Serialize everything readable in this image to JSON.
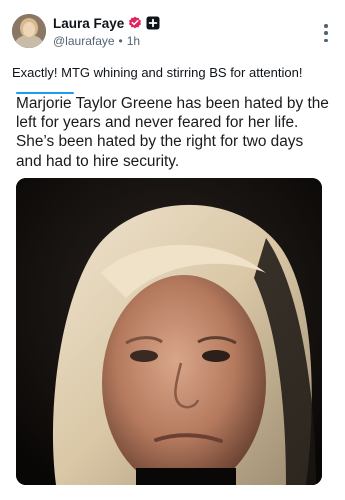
{
  "author": {
    "display_name": "Laura Faye",
    "handle": "@laurafaye",
    "separator": "•",
    "time_ago": "1h",
    "verified_badge_color": "#e0245e"
  },
  "post": {
    "text": "Exactly! MTG whining and stirring BS for attention!"
  },
  "quoted_image": {
    "caption_text": "Marjorie Taylor Greene has been hated by the left for years and never feared for her life. She’s been hated by the right for two days and had to hire security."
  },
  "icons": {
    "verified": "verified-badge-icon",
    "subscription": "plus-badge-icon",
    "more": "more-options-icon"
  },
  "colors": {
    "accent": "#1d9bf0",
    "text": "#0f1419",
    "muted": "#536471"
  }
}
